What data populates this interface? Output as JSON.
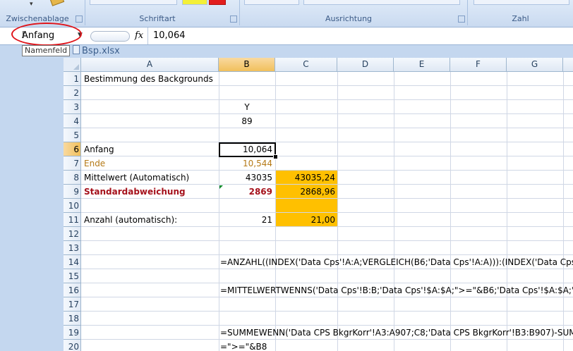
{
  "ribbon": {
    "groups": [
      {
        "label": "Zwischenablage"
      },
      {
        "label": "Schriftart"
      },
      {
        "label": "Ausrichtung"
      },
      {
        "label": "Zahl"
      }
    ]
  },
  "formula_bar": {
    "name_box": "Anfang",
    "fx_label": "fx",
    "value": "10,064",
    "tooltip": "Namenfeld"
  },
  "workbook": {
    "title": "Bsp.xlsx"
  },
  "sheet": {
    "columns": [
      "A",
      "B",
      "C",
      "D",
      "E",
      "F",
      "G"
    ],
    "rows": [
      "1",
      "2",
      "3",
      "4",
      "5",
      "6",
      "7",
      "8",
      "9",
      "10",
      "11",
      "12",
      "13",
      "14",
      "15",
      "16",
      "17",
      "18",
      "19",
      "20"
    ],
    "cells": {
      "a1": "Bestimmung des Backgrounds",
      "b3": "Y",
      "b4": "89",
      "a6": "Anfang",
      "b6": "10,064",
      "a7": "Ende",
      "b7": "10,544",
      "a8": "Mittelwert (Automatisch)",
      "b8": "43035",
      "c8": "43035,24",
      "a9": "Standardabweichung",
      "b9": "2869",
      "c9": "2868,96",
      "a11": "Anzahl (automatisch):",
      "b11": "21",
      "c11": "21,00",
      "b14": "=ANZAHL((INDEX('Data Cps'!A:A;VERGLEICH(B6;'Data Cps'!A:A))):(INDEX('Data Cps",
      "b16": "=MITTELWERTWENNS('Data Cps'!B:B;'Data Cps'!$A:$A;\">=\"&B6;'Data Cps'!$A:$A;\"<",
      "b19": "=SUMMEWENN('Data CPS BkgrKorr'!A3:A907;C8;'Data CPS BkgrKorr'!B3:B907)-SUM",
      "b20": "=\">=\"&B8"
    },
    "colors": {
      "highlight": "#ffc000",
      "ende": "#b57a17",
      "std": "#a5111c",
      "selection": "#f1c05c"
    }
  }
}
